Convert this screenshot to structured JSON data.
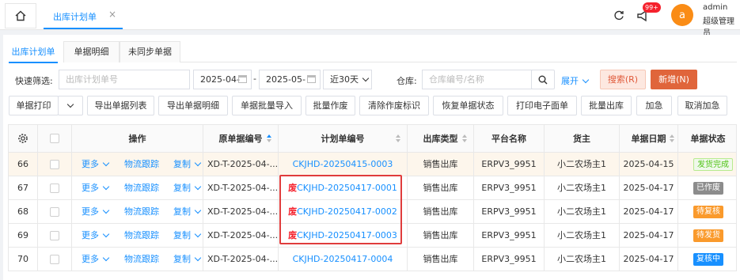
{
  "topbar": {
    "tab_label": "出库计划单",
    "close_glyph": "×",
    "notify_badge": "99+",
    "avatar_letter": "a",
    "user_name": "admin",
    "user_role": "超级管理员"
  },
  "subtabs": [
    "出库计划单",
    "单据明细",
    "未同步单据"
  ],
  "filter": {
    "quick_label": "快速筛选:",
    "quick_placeholder": "出库计划单号",
    "date_from": "2025-04-",
    "date_sep": "-",
    "date_to": "2025-05-",
    "range": "近30天",
    "warehouse_label": "仓库:",
    "warehouse_placeholder": "仓库编号/名称",
    "expand": "展开",
    "search": "搜索(R)",
    "new": "新增(N)"
  },
  "actions": [
    "单据打印",
    "导出单据列表",
    "导出单据明细",
    "单据批量导入",
    "批量作废",
    "清除作废标识",
    "恢复单据状态",
    "打印电子面单",
    "批量出库",
    "加急",
    "取消加急"
  ],
  "table": {
    "headers": {
      "op": "操作",
      "orig": "原单据编号",
      "plan": "计划单编号",
      "type": "出库类型",
      "platform": "平台名称",
      "owner": "货主",
      "date": "单据日期",
      "status": "单据状态"
    },
    "row_links": {
      "more": "更多",
      "track": "物流跟踪",
      "copy": "复制"
    },
    "void_mark": "废",
    "rows": [
      {
        "idx": "66",
        "orig": "XD-T-2025-04-...",
        "plan": "CKJHD-20250415-0003",
        "void": false,
        "type": "销售出库",
        "platform": "ERPV3_9951",
        "owner": "小二农场主1",
        "date": "2025-04-15",
        "status": "发货完成",
        "status_kind": "green"
      },
      {
        "idx": "67",
        "orig": "XD-T-2025-04-...",
        "plan": "CKJHD-20250417-0001",
        "void": true,
        "type": "销售出库",
        "platform": "ERPV3_9951",
        "owner": "小二农场主1",
        "date": "2025-04-17",
        "status": "已作废",
        "status_kind": "gray"
      },
      {
        "idx": "68",
        "orig": "XD-T-2025-04-...",
        "plan": "CKJHD-20250417-0002",
        "void": true,
        "type": "销售出库",
        "platform": "ERPV3_9951",
        "owner": "小二农场主1",
        "date": "2025-04-17",
        "status": "待复核",
        "status_kind": "orange"
      },
      {
        "idx": "69",
        "orig": "XD-T-2025-04-...",
        "plan": "CKJHD-20250417-0003",
        "void": true,
        "type": "销售出库",
        "platform": "ERPV3_9951",
        "owner": "小二农场主1",
        "date": "2025-04-17",
        "status": "待发货",
        "status_kind": "orange"
      },
      {
        "idx": "70",
        "orig": "XD-T-2025-04-...",
        "plan": "CKJHD-20250417-0004",
        "void": false,
        "type": "销售出库",
        "platform": "ERPV3_9951",
        "owner": "小二农场主1",
        "date": "2025-04-17",
        "status": "复核中",
        "status_kind": "blue"
      }
    ]
  },
  "colors": {
    "accent": "#1890ff",
    "danger": "#f5222d",
    "brand": "#e0653b"
  }
}
